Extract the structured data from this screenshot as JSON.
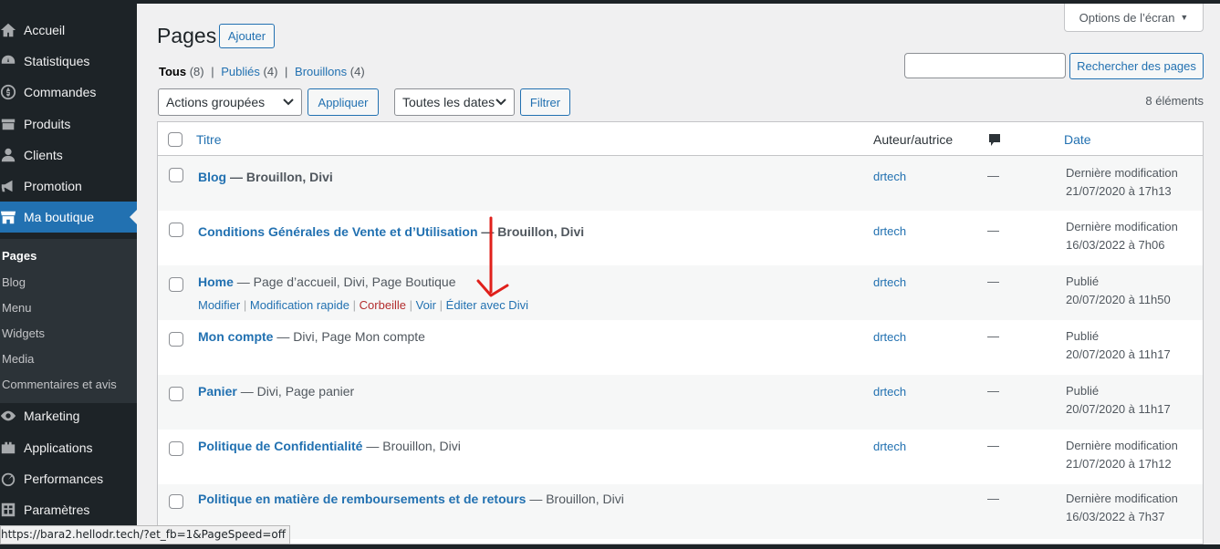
{
  "sidebar": {
    "items": [
      {
        "label": "Accueil",
        "icon": "home-icon"
      },
      {
        "label": "Statistiques",
        "icon": "stats-icon"
      },
      {
        "label": "Commandes",
        "icon": "dollar-icon"
      },
      {
        "label": "Produits",
        "icon": "archive-icon"
      },
      {
        "label": "Clients",
        "icon": "user-icon"
      },
      {
        "label": "Promotion",
        "icon": "megaphone-icon"
      },
      {
        "label": "Ma boutique",
        "icon": "store-icon"
      },
      {
        "label": "Marketing",
        "icon": "marketing-icon"
      },
      {
        "label": "Applications",
        "icon": "plugin-icon"
      },
      {
        "label": "Performances",
        "icon": "gauge-icon"
      },
      {
        "label": "Paramètres",
        "icon": "settings-icon"
      }
    ],
    "submenu": [
      "Pages",
      "Blog",
      "Menu",
      "Widgets",
      "Media",
      "Commentaires et avis"
    ]
  },
  "header": {
    "title": "Pages",
    "add_label": "Ajouter",
    "screen_options": "Options de l’écran"
  },
  "filters": {
    "all": "Tous",
    "all_count": "(8)",
    "published": "Publiés",
    "published_count": "(4)",
    "drafts": "Brouillons",
    "drafts_count": "(4)",
    "sep": "|"
  },
  "search": {
    "value": "",
    "button": "Rechercher des pages"
  },
  "bulk": {
    "selected": "Actions groupées",
    "apply": "Appliquer"
  },
  "dates": {
    "selected": "Toutes les dates",
    "filter": "Filtrer"
  },
  "items_count": "8 éléments",
  "table": {
    "col_title": "Titre",
    "col_author": "Auteur/autrice",
    "col_comments_icon": "comment-icon",
    "col_date": "Date",
    "rows": [
      {
        "title": "Blog",
        "state": " — Brouillon, Divi",
        "author": "drtech",
        "comments": "—",
        "date_status": "Dernière modification",
        "date": "21/07/2020 à 17h13"
      },
      {
        "title": "Conditions Générales de Vente et d’Utilisation",
        "state": " — Brouillon, Divi",
        "author": "drtech",
        "comments": "—",
        "date_status": "Dernière modification",
        "date": "16/03/2022 à 7h06"
      },
      {
        "title": "Home",
        "state": " — Page d’accueil, Divi, Page Boutique",
        "author": "drtech",
        "comments": "—",
        "date_status": "Publié",
        "date": "20/07/2020 à 11h50"
      },
      {
        "title": "Mon compte",
        "state": " — Divi, Page Mon compte",
        "author": "drtech",
        "comments": "—",
        "date_status": "Publié",
        "date": "20/07/2020 à 11h17"
      },
      {
        "title": "Panier",
        "state": " — Divi, Page panier",
        "author": "drtech",
        "comments": "—",
        "date_status": "Publié",
        "date": "20/07/2020 à 11h17"
      },
      {
        "title": "Politique de Confidentialité",
        "state": " — Brouillon, Divi",
        "author": "drtech",
        "comments": "—",
        "date_status": "Dernière modification",
        "date": "21/07/2020 à 17h12"
      },
      {
        "title": "Politique en matière de remboursements et de retours",
        "state": " — Brouillon, Divi",
        "author": "",
        "comments": "—",
        "date_status": "Dernière modification",
        "date": "16/03/2022 à 7h37"
      }
    ],
    "row_actions": {
      "edit": "Modifier",
      "quick_edit": "Modification rapide",
      "trash": "Corbeille",
      "view": "Voir",
      "divi": "Éditer avec Divi",
      "sep": "|"
    }
  },
  "statusbar": "https://bara2.hellodr.tech/?et_fb=1&PageSpeed=off",
  "colors": {
    "accent": "#2271b1",
    "sidebar": "#1d2327",
    "annotation": "#e0201b"
  }
}
